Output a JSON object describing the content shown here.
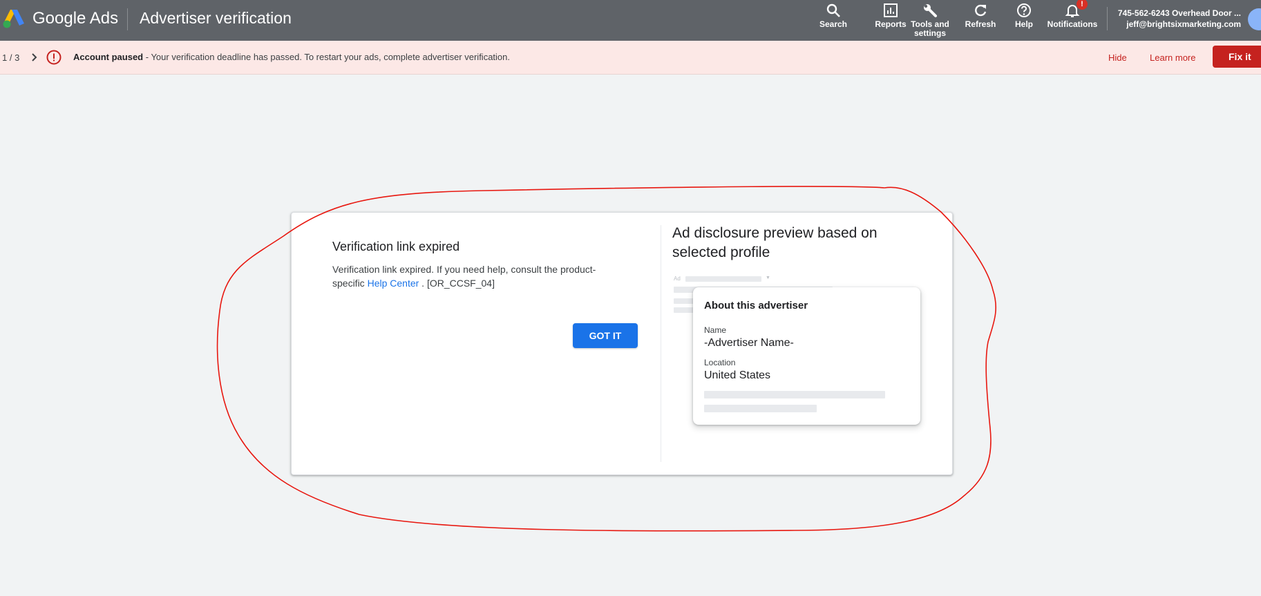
{
  "header": {
    "product_name": "Google Ads",
    "page_title": "Advertiser verification",
    "logo_icon": "google-ads-logo",
    "tools": [
      {
        "label": "Search",
        "icon": "search-icon"
      },
      {
        "label": "Reports",
        "icon": "reports-icon"
      },
      {
        "label": "Tools and settings",
        "icon": "wrench-icon"
      },
      {
        "label": "Refresh",
        "icon": "refresh-icon"
      },
      {
        "label": "Help",
        "icon": "help-icon"
      },
      {
        "label": "Notifications",
        "icon": "bell-icon",
        "badge": "!"
      }
    ],
    "account_name": "745-562-6243 Overhead Door ...",
    "account_email": "jeff@brightsixmarketing.com"
  },
  "banner": {
    "pager": "1 / 3",
    "status_label": "Account paused",
    "message": " - Your verification deadline has passed. To restart your ads, complete advertiser verification.",
    "hide_label": "Hide",
    "learn_more_label": "Learn more",
    "fix_label": "Fix it",
    "color": "#c5221f"
  },
  "dialog": {
    "title": "Verification link expired",
    "body_before": "Verification link expired. If you need help, consult the product-specific ",
    "help_link": "Help Center",
    "body_after": " . [OR_CCSF_04]",
    "button_label": "GOT IT",
    "preview_title": "Ad disclosure preview based on selected profile",
    "ad_label": "Ad",
    "about_card": {
      "title": "About this advertiser",
      "name_label": "Name",
      "name_value": "-Advertiser Name-",
      "location_label": "Location",
      "location_value": "United States"
    }
  },
  "colors": {
    "topbar": "#5f6368",
    "banner_bg": "#fce8e6",
    "primary": "#1a73e8",
    "annotation": "#e8170f"
  }
}
